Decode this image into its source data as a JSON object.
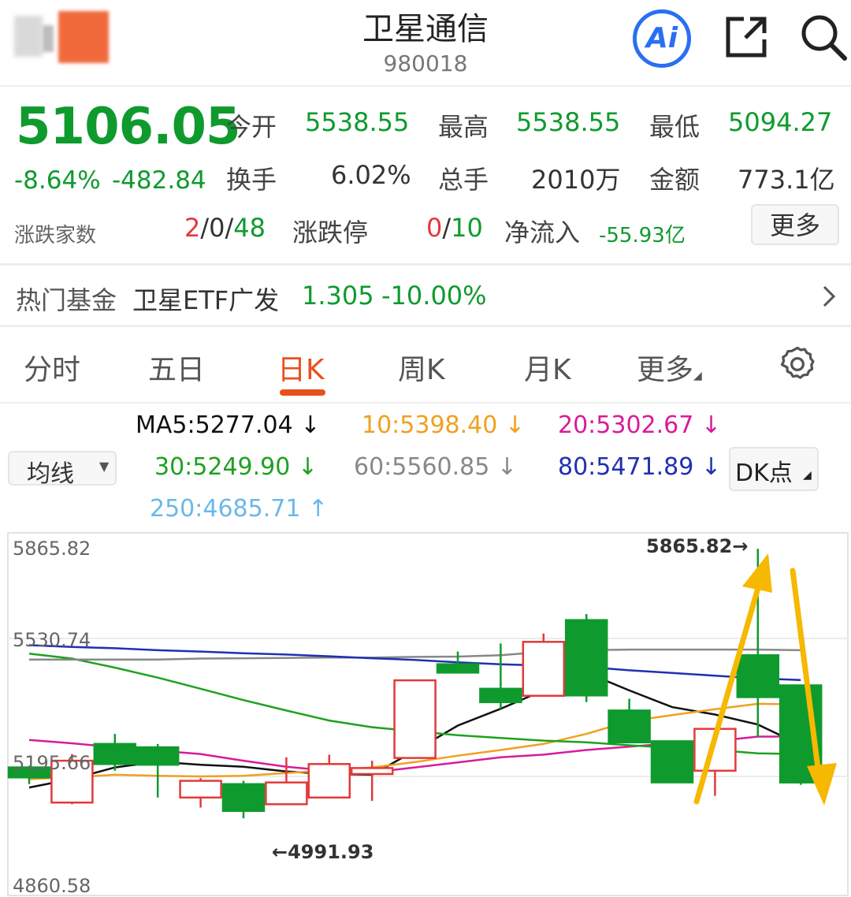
{
  "header": {
    "title": "卫星通信",
    "code": "980018",
    "ai_label": "Ai"
  },
  "quote": {
    "price": "5106.05",
    "change_pct": "-8.64%",
    "change_val": "-482.84",
    "open_label": "今开",
    "open": "5538.55",
    "high_label": "最高",
    "high": "5538.55",
    "low_label": "最低",
    "low": "5094.27",
    "turnover_label": "换手",
    "turnover": "6.02%",
    "volume_label": "总手",
    "volume": "2010万",
    "amount_label": "金额",
    "amount": "773.1亿",
    "breadth_label": "涨跌家数",
    "breadth_up": "2",
    "breadth_flat": "0",
    "breadth_down": "48",
    "breadth_sep": "/",
    "limit_label": "涨跌停",
    "limit_up": "0",
    "limit_down": "10",
    "inflow_label": "净流入",
    "inflow": "-55.93亿",
    "more_label": "更多"
  },
  "fund": {
    "label": "热门基金",
    "name": "卫星ETF广发",
    "price": "1.305",
    "change": "-10.00%"
  },
  "tabs": [
    "分时",
    "五日",
    "日K",
    "周K",
    "月K",
    "更多"
  ],
  "active_tab": "日K",
  "indicators": {
    "selector_label": "均线",
    "dk_label": "DK点",
    "ma5": "MA5:5277.04",
    "ma10": "10:5398.40",
    "ma20": "20:5302.67",
    "ma30": "30:5249.90",
    "ma60": "60:5560.85",
    "ma80": "80:5471.89",
    "ma250": "250:4685.71",
    "down_arrow": "↓",
    "up_arrow": "↑"
  },
  "colors": {
    "up": "#e23a3a",
    "down": "#0f9a2e",
    "accent": "#e8501c",
    "ai_blue": "#2a6ff2",
    "ma5": "#111111",
    "ma10": "#f0a020",
    "ma20": "#d61c9b",
    "ma30": "#20a020",
    "ma60": "#888888",
    "ma80": "#2030b0",
    "ma250": "#6bb8e8",
    "annotation_arrow": "#f6b800"
  },
  "chart_data": {
    "type": "candlestick",
    "y_ticks": [
      "5865.82",
      "5530.74",
      "5195.66",
      "4860.58"
    ],
    "ylim": [
      4860.58,
      5865.82
    ],
    "max_label": "5865.82→",
    "min_label": "←4991.93",
    "candles": [
      {
        "o": 5210,
        "c": 5180,
        "h": 5215,
        "l": 5160
      },
      {
        "o": 5105,
        "c": 5230,
        "h": 5250,
        "l": 5100
      },
      {
        "o": 5280,
        "c": 5220,
        "h": 5310,
        "l": 5200
      },
      {
        "o": 5270,
        "c": 5218,
        "h": 5280,
        "l": 5120
      },
      {
        "o": 5120,
        "c": 5170,
        "h": 5178,
        "l": 5090
      },
      {
        "o": 5160,
        "c": 5080,
        "h": 5170,
        "l": 5058
      },
      {
        "o": 5100,
        "c": 5165,
        "h": 5240,
        "l": 5100
      },
      {
        "o": 5120,
        "c": 5220,
        "h": 5248,
        "l": 5120
      },
      {
        "o": 5190,
        "c": 5208,
        "h": 5230,
        "l": 5110
      },
      {
        "o": 5238,
        "c": 5470,
        "h": 5470,
        "l": 5238
      },
      {
        "o": 5518,
        "c": 5493,
        "h": 5556,
        "l": 5493
      },
      {
        "o": 5445,
        "c": 5405,
        "h": 5580,
        "l": 5385
      },
      {
        "o": 5424,
        "c": 5585,
        "h": 5610,
        "l": 5424
      },
      {
        "o": 5650,
        "c": 5425,
        "h": 5668,
        "l": 5405
      },
      {
        "o": 5380,
        "c": 5285,
        "h": 5415,
        "l": 5285
      },
      {
        "o": 5288,
        "c": 5165,
        "h": 5278,
        "l": 5165
      },
      {
        "o": 5200,
        "c": 5325,
        "h": 5325,
        "l": 5125
      },
      {
        "o": 5545,
        "c": 5420,
        "h": 5863,
        "l": 5300
      },
      {
        "o": 5455,
        "c": 5165,
        "h": 5455,
        "l": 5158
      }
    ],
    "ma_lines": {
      "ma5": [
        5150,
        5175,
        5210,
        5227,
        5218,
        5212,
        5198,
        5190,
        5188,
        5260,
        5335,
        5385,
        5440,
        5493,
        5440,
        5390,
        5368,
        5338,
        5277
      ],
      "ma10": [
        5175,
        5180,
        5188,
        5185,
        5183,
        5185,
        5193,
        5202,
        5210,
        5226,
        5245,
        5262,
        5280,
        5310,
        5348,
        5366,
        5384,
        5400,
        5398
      ],
      "ma20": [
        5292,
        5282,
        5270,
        5260,
        5250,
        5230,
        5212,
        5200,
        5195,
        5210,
        5225,
        5240,
        5248,
        5262,
        5272,
        5282,
        5288,
        5302,
        5302
      ],
      "ma30": [
        5550,
        5535,
        5508,
        5478,
        5445,
        5411,
        5380,
        5350,
        5330,
        5318,
        5306,
        5298,
        5290,
        5285,
        5276,
        5268,
        5262,
        5252,
        5250
      ],
      "ma60": [
        5532,
        5532,
        5532,
        5532,
        5535,
        5536,
        5537,
        5538,
        5538,
        5540,
        5541,
        5545,
        5555,
        5560,
        5562,
        5562,
        5562,
        5562,
        5560
      ],
      "ma80": [
        5575,
        5570,
        5566,
        5560,
        5556,
        5551,
        5547,
        5542,
        5536,
        5531,
        5524,
        5518,
        5514,
        5510,
        5500,
        5492,
        5484,
        5476,
        5471
      ]
    }
  }
}
